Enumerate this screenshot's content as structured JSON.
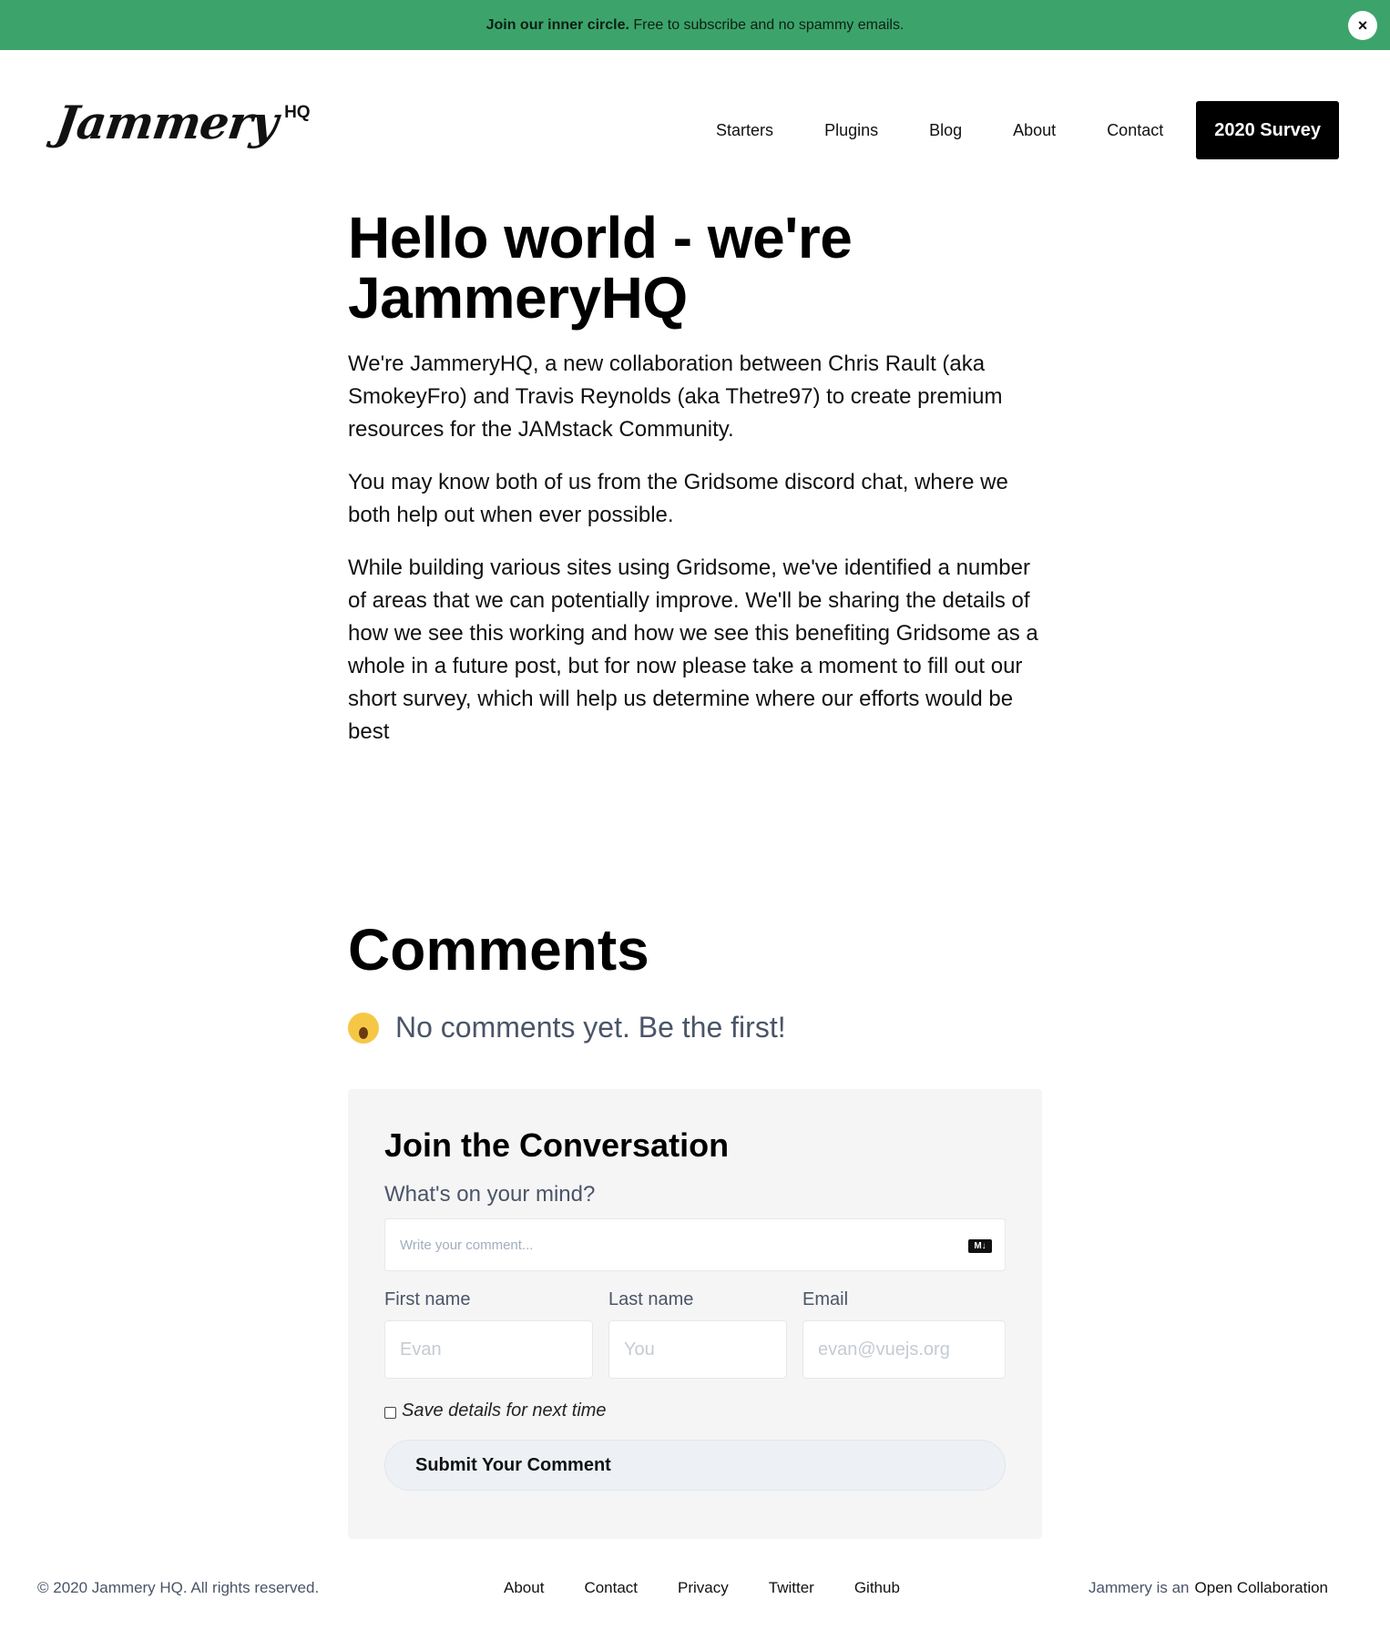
{
  "banner": {
    "bold": "Join our inner circle.",
    "text": " Free to subscribe and no spammy emails.",
    "close_label": "×",
    "color": "#3ca46b"
  },
  "header": {
    "logo_script": "Jammery",
    "logo_hq": "HQ",
    "nav": [
      "Starters",
      "Plugins",
      "Blog",
      "About",
      "Contact"
    ],
    "survey_button": "2020 Survey"
  },
  "article": {
    "title": "Hello world - we're JammeryHQ",
    "paragraphs": [
      "We're JammeryHQ, a new collaboration between Chris Rault (aka SmokeyFro) and Travis Reynolds (aka Thetre97) to create premium resources for the JAMstack Community.",
      "You may know both of us from the Gridsome discord chat, where we both help out when ever possible.",
      "While building various sites using Gridsome, we've identified a number of areas that we can potentially improve. We'll be sharing the details of how we see this working and how we see this benefiting Gridsome as a whole in a future post, but for now please take a moment to fill out our short survey, which will help us determine where our efforts would be best"
    ]
  },
  "comments": {
    "title": "Comments",
    "empty_emoji": "scream-emoji-icon",
    "empty_text": "No comments yet. Be the first!"
  },
  "form": {
    "title": "Join the Conversation",
    "prompt": "What's on your mind?",
    "comment_placeholder": "Write your comment...",
    "markdown_icon": "M↓",
    "first_name_label": "First name",
    "first_name_placeholder": "Evan",
    "last_name_label": "Last name",
    "last_name_placeholder": "You",
    "email_label": "Email",
    "email_placeholder": "evan@vuejs.org",
    "save_label": "Save details for next time",
    "submit_label": "Submit Your Comment"
  },
  "footer": {
    "copyright": "© 2020 Jammery HQ. All rights reserved.",
    "links": [
      "About",
      "Contact",
      "Privacy",
      "Twitter",
      "Github"
    ],
    "right_prefix": "Jammery is an",
    "right_link": "Open Collaboration"
  }
}
